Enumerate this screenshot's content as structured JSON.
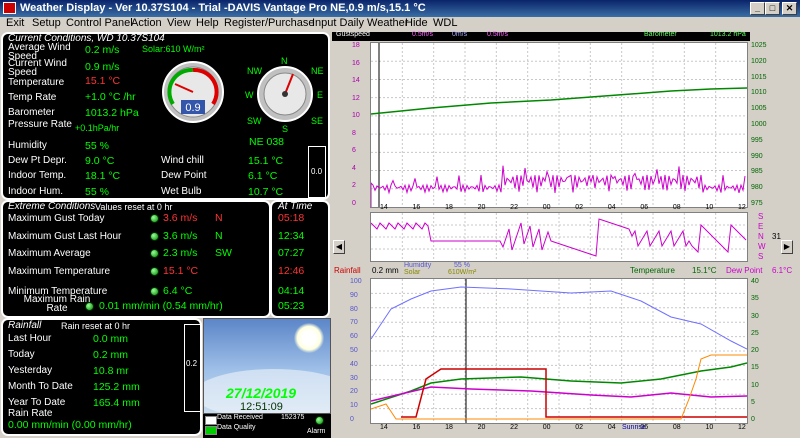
{
  "titlebar": {
    "title": "Weather Display - Ver 10.37S104 - Trial  -DAVIS Vantage Pro  NE,0.9 m/s,15.1 °C"
  },
  "menu": [
    "Exit",
    "Setup",
    "Control Panel",
    "Action",
    "View",
    "Help",
    "Register/Purchase",
    "Input Daily Weather",
    "Hide",
    "WDL"
  ],
  "current": {
    "heading": "Current Conditions, WD 10.37S104",
    "avg_wind_label": "Average Wind Speed",
    "avg_wind": "0.2 m/s",
    "solar": "Solar:610 W/m²",
    "cur_wind_label": "Current Wind Speed",
    "cur_wind": "0.9 m/s",
    "temp_label": "Temperature",
    "temp": "15.1 °C",
    "temp_rate_label": "Temp Rate",
    "temp_rate": "+1.0 °C /hr",
    "baro_label": "Barometer",
    "baro": "1013.2 hPa",
    "press_rate_label": "Pressure Rate",
    "press_rate": "+0.1hPa/hr",
    "humidity_label": "Humidity",
    "humidity": "55 %",
    "dew_depr_label": "Dew Pt Depr.",
    "dew_depr": "9.0 °C",
    "indoor_temp_label": "Indoor Temp.",
    "indoor_temp": "18.1 °C",
    "indoor_hum_label": "Indoor Hum.",
    "indoor_hum": "55 %",
    "wind_chill_label": "Wind chill",
    "wind_chill": "15.1 °C",
    "dew_point_label": "Dew Point",
    "dew_point": "6.1 °C",
    "wet_bulb_label": "Wet Bulb",
    "wet_bulb": "10.7 °C",
    "wind_dir": "NE 038",
    "gauge_value": "0.9",
    "side_value": "0.0",
    "compass": {
      "n": "N",
      "ne": "NE",
      "e": "E",
      "se": "SE",
      "s": "S",
      "sw": "SW",
      "w": "W",
      "nw": "NW"
    }
  },
  "extremes": {
    "heading": "Extreme Conditions",
    "reset": "Values reset at 0 hr",
    "at_time": "At Time",
    "rows": [
      {
        "label": "Maximum Gust Today",
        "value": "3.6 m/s",
        "extra": "N",
        "time": "05:18",
        "color": "red"
      },
      {
        "label": "Maximum Gust Last Hour",
        "value": "3.6 m/s",
        "extra": "N",
        "time": "12:34",
        "color": "green"
      },
      {
        "label": "Maximum Average",
        "value": "2.3 m/s",
        "extra": "SW",
        "time": "07:27",
        "color": "green"
      },
      {
        "label": "Maximum Temperature",
        "value": "15.1 °C",
        "extra": "",
        "time": "12:46",
        "color": "red"
      },
      {
        "label": "Minimum Temperature",
        "value": "6.4 °C",
        "extra": "",
        "time": "04:14",
        "color": "green"
      },
      {
        "label": "Maximum Rain Rate",
        "value": "0.01 mm/min (0.54 mm/hr)",
        "extra": "",
        "time": "05:23",
        "color": "green"
      }
    ]
  },
  "rain": {
    "heading": "Rainfall",
    "reset": "Rain reset at 0 hr",
    "rows": [
      {
        "label": "Last Hour",
        "value": "0.0 mm"
      },
      {
        "label": "Today",
        "value": "0.2 mm"
      },
      {
        "label": "Yesterday",
        "value": "10.8 mr"
      },
      {
        "label": "Month To Date",
        "value": "125.2 mm"
      },
      {
        "label": "Year To Date",
        "value": "165.4 mm"
      }
    ],
    "rate_label": "Rain Rate",
    "rate": "0.00 mm/min (0.00 mm/hr)",
    "side": "0.2"
  },
  "clock": {
    "date": "27/12/2019",
    "time": "12:51:09"
  },
  "status": {
    "received": "Data Received",
    "quality": "Data Quality",
    "counter": "152375",
    "alarm": "Alarm"
  },
  "graph_top": {
    "legend_left": "Gustspeed",
    "v1": "0.5m/s",
    "v2": "0m/s",
    "v3": "0.5m/s",
    "legend_right": "Barometer",
    "v4": "1013.2 hPa",
    "right_axis": [
      "1025",
      "1020",
      "1015",
      "1010",
      "1005",
      "1000",
      "995",
      "990",
      "985",
      "980",
      "975"
    ],
    "left_axis": [
      "18",
      "16",
      "14",
      "12",
      "10",
      "8",
      "6",
      "4",
      "2",
      "0"
    ],
    "x_axis": [
      "14",
      "16",
      "18",
      "20",
      "22",
      "00",
      "02",
      "04",
      "06",
      "08",
      "10",
      "12"
    ]
  },
  "graph_mid": {
    "letters": [
      "S",
      "E",
      "N",
      "W",
      "S"
    ],
    "right": "31"
  },
  "graph_bottom": {
    "rainfall": "Rainfall",
    "rain_val": "0.2 mm",
    "humidity": "Humidity",
    "solar": "Solar",
    "hum_val": "55 %",
    "solar_val": "610W/m²",
    "temperature": "Temperature",
    "temp_val": "15.1°C",
    "dewpoint": "Dew Point",
    "dew_val": "6.1°C",
    "left_axis": [
      "100",
      "90",
      "80",
      "70",
      "60",
      "50",
      "40",
      "30",
      "20",
      "10",
      "0"
    ],
    "right_axis": [
      "40",
      "35",
      "30",
      "25",
      "20",
      "15",
      "10",
      "5",
      "0"
    ],
    "x_axis": [
      "14",
      "16",
      "18",
      "20",
      "22",
      "00",
      "02",
      "04",
      "06",
      "08",
      "10",
      "12"
    ],
    "sunrise": "Sunrise"
  },
  "colors": {
    "panel_bg": "#000000",
    "value_green": "#00ff00",
    "value_red": "#ff3333",
    "baro_line": "#008800",
    "gust": "#cc00cc",
    "humidity_line": "#7070ff",
    "rain_line": "#cc0000"
  }
}
